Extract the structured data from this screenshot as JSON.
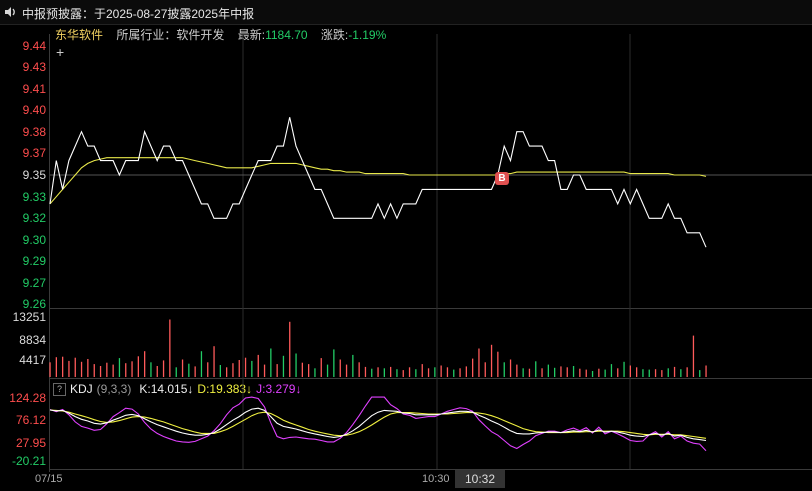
{
  "notice": {
    "text": "中报预披露：于2025-08-27披露2025年中报"
  },
  "stock": {
    "name": "东华软件",
    "industry": "所属行业：软件开发",
    "latest_label": "最新:",
    "latest_value": "1184.70",
    "change_label": "涨跌:",
    "change_value": "-1.19%"
  },
  "crosshair_symbol": "+",
  "price_axis": [
    "9.44",
    "9.43",
    "9.41",
    "9.40",
    "9.38",
    "9.37",
    "9.35",
    "9.33",
    "9.32",
    "9.30",
    "9.29",
    "9.27",
    "9.26"
  ],
  "volume_axis": [
    "13251",
    "8834",
    "4417"
  ],
  "kdj": {
    "help_symbol": "?",
    "name": "KDJ",
    "params": "(9,3,3)",
    "k_text": "K:14.015↓",
    "d_text": "D:19.383↓",
    "j_text": "J:3.279↓",
    "axis": [
      "124.28",
      "76.12",
      "27.95",
      "-20.21"
    ]
  },
  "x_axis": {
    "start": "07/15",
    "mid": "10:30",
    "selected": "10:32"
  },
  "buy_marker": "B",
  "colors": {
    "price_line": "#ffffff",
    "avg_line": "#e8e84a",
    "vol_up": "#ff5a5a",
    "vol_down": "#22cc66",
    "k_line": "#ffffff",
    "d_line": "#f0f040",
    "j_line": "#e040ff"
  },
  "chart_data": {
    "type": "line",
    "ylim": [
      9.26,
      9.44
    ],
    "series": [
      {
        "values": [
          9.33,
          9.36,
          9.34,
          9.36,
          9.37,
          9.38,
          9.37,
          9.37,
          9.36,
          9.36,
          9.36,
          9.35,
          9.36,
          9.36,
          9.36,
          9.38,
          9.37,
          9.36,
          9.37,
          9.37,
          9.36,
          9.36,
          9.35,
          9.34,
          9.33,
          9.33,
          9.32,
          9.32,
          9.32,
          9.33,
          9.33,
          9.34,
          9.35,
          9.36,
          9.36,
          9.36,
          9.37,
          9.37,
          9.39,
          9.37,
          9.36,
          9.35,
          9.34,
          9.34,
          9.33,
          9.32,
          9.32,
          9.32,
          9.32,
          9.32,
          9.32,
          9.32,
          9.33,
          9.32,
          9.33,
          9.32,
          9.33,
          9.33,
          9.33,
          9.34,
          9.34,
          9.34,
          9.34,
          9.34,
          9.34,
          9.34,
          9.34,
          9.34,
          9.34,
          9.34,
          9.34,
          9.35,
          9.37,
          9.36,
          9.38,
          9.38,
          9.37,
          9.37,
          9.37,
          9.36,
          9.36,
          9.34,
          9.34,
          9.35,
          9.35,
          9.34,
          9.34,
          9.34,
          9.34,
          9.34,
          9.33,
          9.34,
          9.33,
          9.34,
          9.33,
          9.32,
          9.32,
          9.32,
          9.33,
          9.32,
          9.32,
          9.31,
          9.31,
          9.31,
          9.3
        ]
      },
      {
        "values": [
          9.33,
          9.335,
          9.34,
          9.345,
          9.35,
          9.355,
          9.358,
          9.36,
          9.361,
          9.362,
          9.362,
          9.362,
          9.362,
          9.362,
          9.362,
          9.362,
          9.362,
          9.362,
          9.362,
          9.362,
          9.362,
          9.362,
          9.361,
          9.36,
          9.359,
          9.358,
          9.357,
          9.356,
          9.355,
          9.355,
          9.355,
          9.355,
          9.355,
          9.356,
          9.357,
          9.358,
          9.358,
          9.358,
          9.358,
          9.358,
          9.357,
          9.356,
          9.355,
          9.354,
          9.354,
          9.353,
          9.353,
          9.352,
          9.352,
          9.352,
          9.351,
          9.351,
          9.351,
          9.351,
          9.351,
          9.351,
          9.351,
          9.35,
          9.35,
          9.35,
          9.35,
          9.35,
          9.35,
          9.35,
          9.35,
          9.35,
          9.35,
          9.35,
          9.35,
          9.35,
          9.35,
          9.35,
          9.351,
          9.351,
          9.352,
          9.352,
          9.352,
          9.352,
          9.352,
          9.352,
          9.352,
          9.352,
          9.352,
          9.352,
          9.352,
          9.352,
          9.352,
          9.352,
          9.352,
          9.352,
          9.352,
          9.352,
          9.351,
          9.351,
          9.351,
          9.351,
          9.351,
          9.351,
          9.351,
          9.35,
          9.35,
          9.35,
          9.35,
          9.35,
          9.349
        ]
      }
    ],
    "volume": {
      "ylim": [
        0,
        13251
      ],
      "values": [
        3200,
        4300,
        4400,
        3500,
        4200,
        3300,
        3900,
        2800,
        2400,
        3100,
        2700,
        4100,
        3000,
        3400,
        4500,
        5600,
        3200,
        2400,
        3600,
        12500,
        2100,
        3800,
        2900,
        2300,
        5600,
        3200,
        6700,
        2600,
        2100,
        3000,
        3700,
        4200,
        3500,
        4800,
        2700,
        6200,
        2800,
        4600,
        12000,
        5100,
        3100,
        2800,
        1900,
        4100,
        2700,
        6000,
        3800,
        2700,
        4800,
        3200,
        2200,
        1800,
        2100,
        1900,
        2200,
        1700,
        1500,
        2100,
        1700,
        2800,
        1900,
        2100,
        2500,
        2100,
        1600,
        1900,
        2300,
        4000,
        6200,
        3200,
        7000,
        5500,
        3200,
        3800,
        2700,
        1900,
        1800,
        3400,
        1900,
        2700,
        2000,
        2300,
        2100,
        2400,
        1800,
        1600,
        1300,
        1800,
        1600,
        2800,
        1900,
        3300,
        2500,
        2100,
        1700,
        1600,
        1700,
        1500,
        1900,
        2200,
        1700,
        2100,
        9000,
        1500,
        2500
      ],
      "up": [
        true,
        true,
        true,
        true,
        true,
        true,
        true,
        true,
        true,
        true,
        true,
        false,
        true,
        true,
        true,
        true,
        false,
        true,
        true,
        true,
        false,
        true,
        false,
        true,
        false,
        true,
        true,
        false,
        true,
        true,
        true,
        true,
        false,
        true,
        true,
        false,
        true,
        false,
        true,
        false,
        true,
        true,
        false,
        true,
        false,
        false,
        true,
        true,
        false,
        true,
        true,
        false,
        true,
        false,
        true,
        false,
        true,
        true,
        false,
        true,
        true,
        false,
        true,
        true,
        false,
        true,
        true,
        true,
        true,
        true,
        true,
        true,
        false,
        true,
        true,
        false,
        true,
        false,
        true,
        false,
        false,
        true,
        true,
        false,
        true,
        true,
        false,
        true,
        false,
        false,
        true,
        false,
        true,
        true,
        false,
        false,
        true,
        true,
        false,
        true,
        false,
        true,
        true,
        false,
        true
      ]
    },
    "kdj_series": {
      "ylim": [
        -20.21,
        124.28
      ],
      "k": [
        95,
        93,
        94,
        88,
        80,
        74,
        70,
        65,
        63,
        66,
        72,
        77,
        83,
        85,
        82,
        75,
        68,
        62,
        57,
        52,
        47,
        43,
        40,
        38,
        38,
        40,
        44,
        52,
        62,
        72,
        80,
        90,
        97,
        99,
        94,
        80,
        65,
        58,
        55,
        52,
        48,
        44,
        41,
        38,
        35,
        33,
        35,
        40,
        48,
        58,
        70,
        82,
        90,
        94,
        93,
        92,
        88,
        87,
        84,
        84,
        84,
        84,
        86,
        88,
        90,
        92,
        92,
        90,
        83,
        77,
        70,
        64,
        56,
        48,
        42,
        41,
        41,
        43,
        44,
        45,
        45,
        44,
        46,
        48,
        46,
        49,
        45,
        50,
        45,
        47,
        45,
        42,
        38,
        36,
        35,
        39,
        42,
        38,
        42,
        36,
        38,
        33,
        30,
        28,
        26
      ],
      "d": [
        95,
        94,
        93,
        90,
        86,
        82,
        78,
        73,
        69,
        67,
        68,
        71,
        75,
        79,
        80,
        79,
        76,
        72,
        68,
        63,
        58,
        53,
        49,
        45,
        42,
        42,
        42,
        46,
        51,
        58,
        66,
        74,
        82,
        88,
        90,
        87,
        80,
        72,
        66,
        61,
        56,
        51,
        47,
        44,
        41,
        38,
        37,
        38,
        41,
        46,
        53,
        61,
        70,
        79,
        86,
        89,
        89,
        89,
        88,
        87,
        86,
        86,
        86,
        86,
        87,
        88,
        89,
        89,
        88,
        86,
        82,
        77,
        71,
        65,
        59,
        53,
        49,
        46,
        45,
        44,
        44,
        44,
        44,
        45,
        45,
        46,
        46,
        47,
        47,
        47,
        47,
        46,
        44,
        42,
        40,
        39,
        40,
        40,
        40,
        39,
        39,
        37,
        35,
        33,
        31
      ],
      "j": [
        96,
        91,
        96,
        84,
        68,
        58,
        54,
        49,
        51,
        64,
        80,
        89,
        99,
        97,
        86,
        67,
        52,
        42,
        35,
        30,
        25,
        23,
        22,
        24,
        30,
        36,
        48,
        64,
        84,
        100,
        108,
        122,
        124,
        121,
        102,
        66,
        35,
        30,
        33,
        34,
        32,
        30,
        29,
        26,
        23,
        23,
        31,
        44,
        62,
        82,
        104,
        124,
        124,
        124,
        107,
        98,
        86,
        83,
        76,
        78,
        80,
        80,
        86,
        92,
        96,
        100,
        98,
        92,
        73,
        59,
        46,
        38,
        26,
        14,
        8,
        17,
        25,
        37,
        42,
        47,
        47,
        44,
        50,
        54,
        48,
        55,
        43,
        56,
        41,
        47,
        41,
        34,
        26,
        24,
        25,
        39,
        46,
        34,
        46,
        30,
        36,
        25,
        20,
        18,
        3
      ]
    }
  }
}
